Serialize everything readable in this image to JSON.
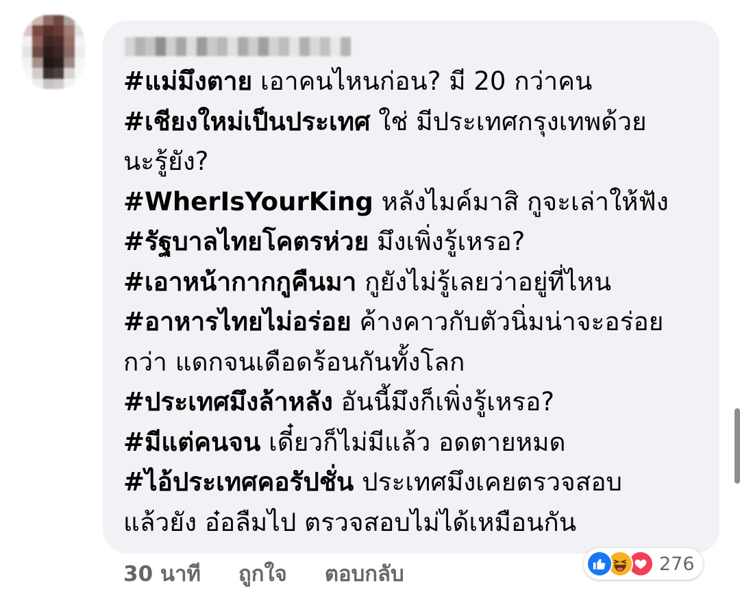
{
  "comment": {
    "lines": [
      {
        "tag": "#แม่มึงตาย",
        "text": " เอาคนไหนก่อน? มี 20 กว่าคน"
      },
      {
        "tag": "#เชียงใหม่เป็นประเทศ",
        "text": " ใช่ มีประเทศกรุงเทพด้วย"
      },
      {
        "tag": "",
        "text": "นะรู้ยัง?"
      },
      {
        "tag": "#WherIsYourKing",
        "text": " หลังไมค์มาสิ กูจะเล่าให้ฟัง"
      },
      {
        "tag": "#รัฐบาลไทยโคตรห่วย",
        "text": " มึงเพิ่งรู้เหรอ?"
      },
      {
        "tag": "#เอาหน้ากากกูคืนมา",
        "text": " กูยังไม่รู้เลยว่าอยู่ที่ไหน"
      },
      {
        "tag": "#อาหารไทยไม่อร่อย",
        "text": " ค้างคาวกับตัวนิ่มน่าจะอร่อย"
      },
      {
        "tag": "",
        "text": "กว่า แดกจนเดือดร้อนกันทั้งโลก"
      },
      {
        "tag": "#ประเทศมึงล้าหลัง",
        "text": " อันนี้มึงก็เพิ่งรู้เหรอ?"
      },
      {
        "tag": "#มีแต่คนจน",
        "text": " เดี๋ยวก็ไม่มีแล้ว อดตายหมด"
      },
      {
        "tag": "#ไอ้ประเทศคอรัปชั่น",
        "text": " ประเทศมึงเคยตรวจสอบ"
      },
      {
        "tag": "",
        "text": "แล้วยัง อ๋อลืมไป ตรวจสอบไม่ได้เหมือนกัน"
      }
    ]
  },
  "actions": {
    "time": "30 นาที",
    "like": "ถูกใจ",
    "reply": "ตอบกลับ"
  },
  "reactions": {
    "icons": [
      "like-icon",
      "haha-icon",
      "love-icon"
    ],
    "count": "276"
  },
  "colors": {
    "bubble": "#f0f2f5",
    "text": "#050505",
    "meta": "#65676b",
    "like": "#1877f2",
    "haha": "#f7b125",
    "love": "#f33e58"
  }
}
